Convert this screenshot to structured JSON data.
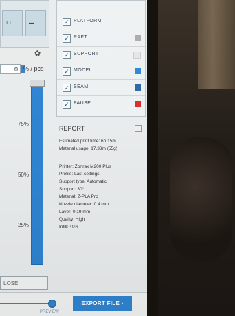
{
  "left_panel": {
    "top_icons": [
      "cube-left",
      "cube-right"
    ],
    "quantity": "0",
    "quantity_unit": "% / pcs",
    "slider_value_pct": 100,
    "ticks": [
      "75%",
      "50%",
      "25%"
    ],
    "close_label": "LOSE"
  },
  "legend": {
    "items": [
      {
        "label": "PLATFORM",
        "checked": true,
        "color": ""
      },
      {
        "label": "RAFT",
        "checked": true,
        "color": "#a9aaa9"
      },
      {
        "label": "SUPPORT",
        "checked": true,
        "color": "#e5e5e3"
      },
      {
        "label": "MODEL",
        "checked": true,
        "color": "#2c86d8"
      },
      {
        "label": "SEAM",
        "checked": true,
        "color": "#2a6aa8"
      },
      {
        "label": "PAUSE",
        "checked": true,
        "color": "#dd2b2b"
      }
    ]
  },
  "report": {
    "title": "REPORT",
    "print_time": "Estimated print time: 6h 15m",
    "material_usage": "Material usage: 17.33m (55g)",
    "printer": "Printer: Zortrax M200 Plus",
    "profile": "Profile: Last settings",
    "support_type": "Support type: Automatic",
    "support": "Support: 30°",
    "material": "Material: Z-PLA Pro",
    "nozzle": "Nozzle diameter: 0.4 mm",
    "layer": "Layer: 0.19 mm",
    "quality": "Quality: High",
    "infill": "Infill: 40%"
  },
  "bottom": {
    "preview_label": "PREVIEW",
    "export_label": "EXPORT FILE ›"
  }
}
